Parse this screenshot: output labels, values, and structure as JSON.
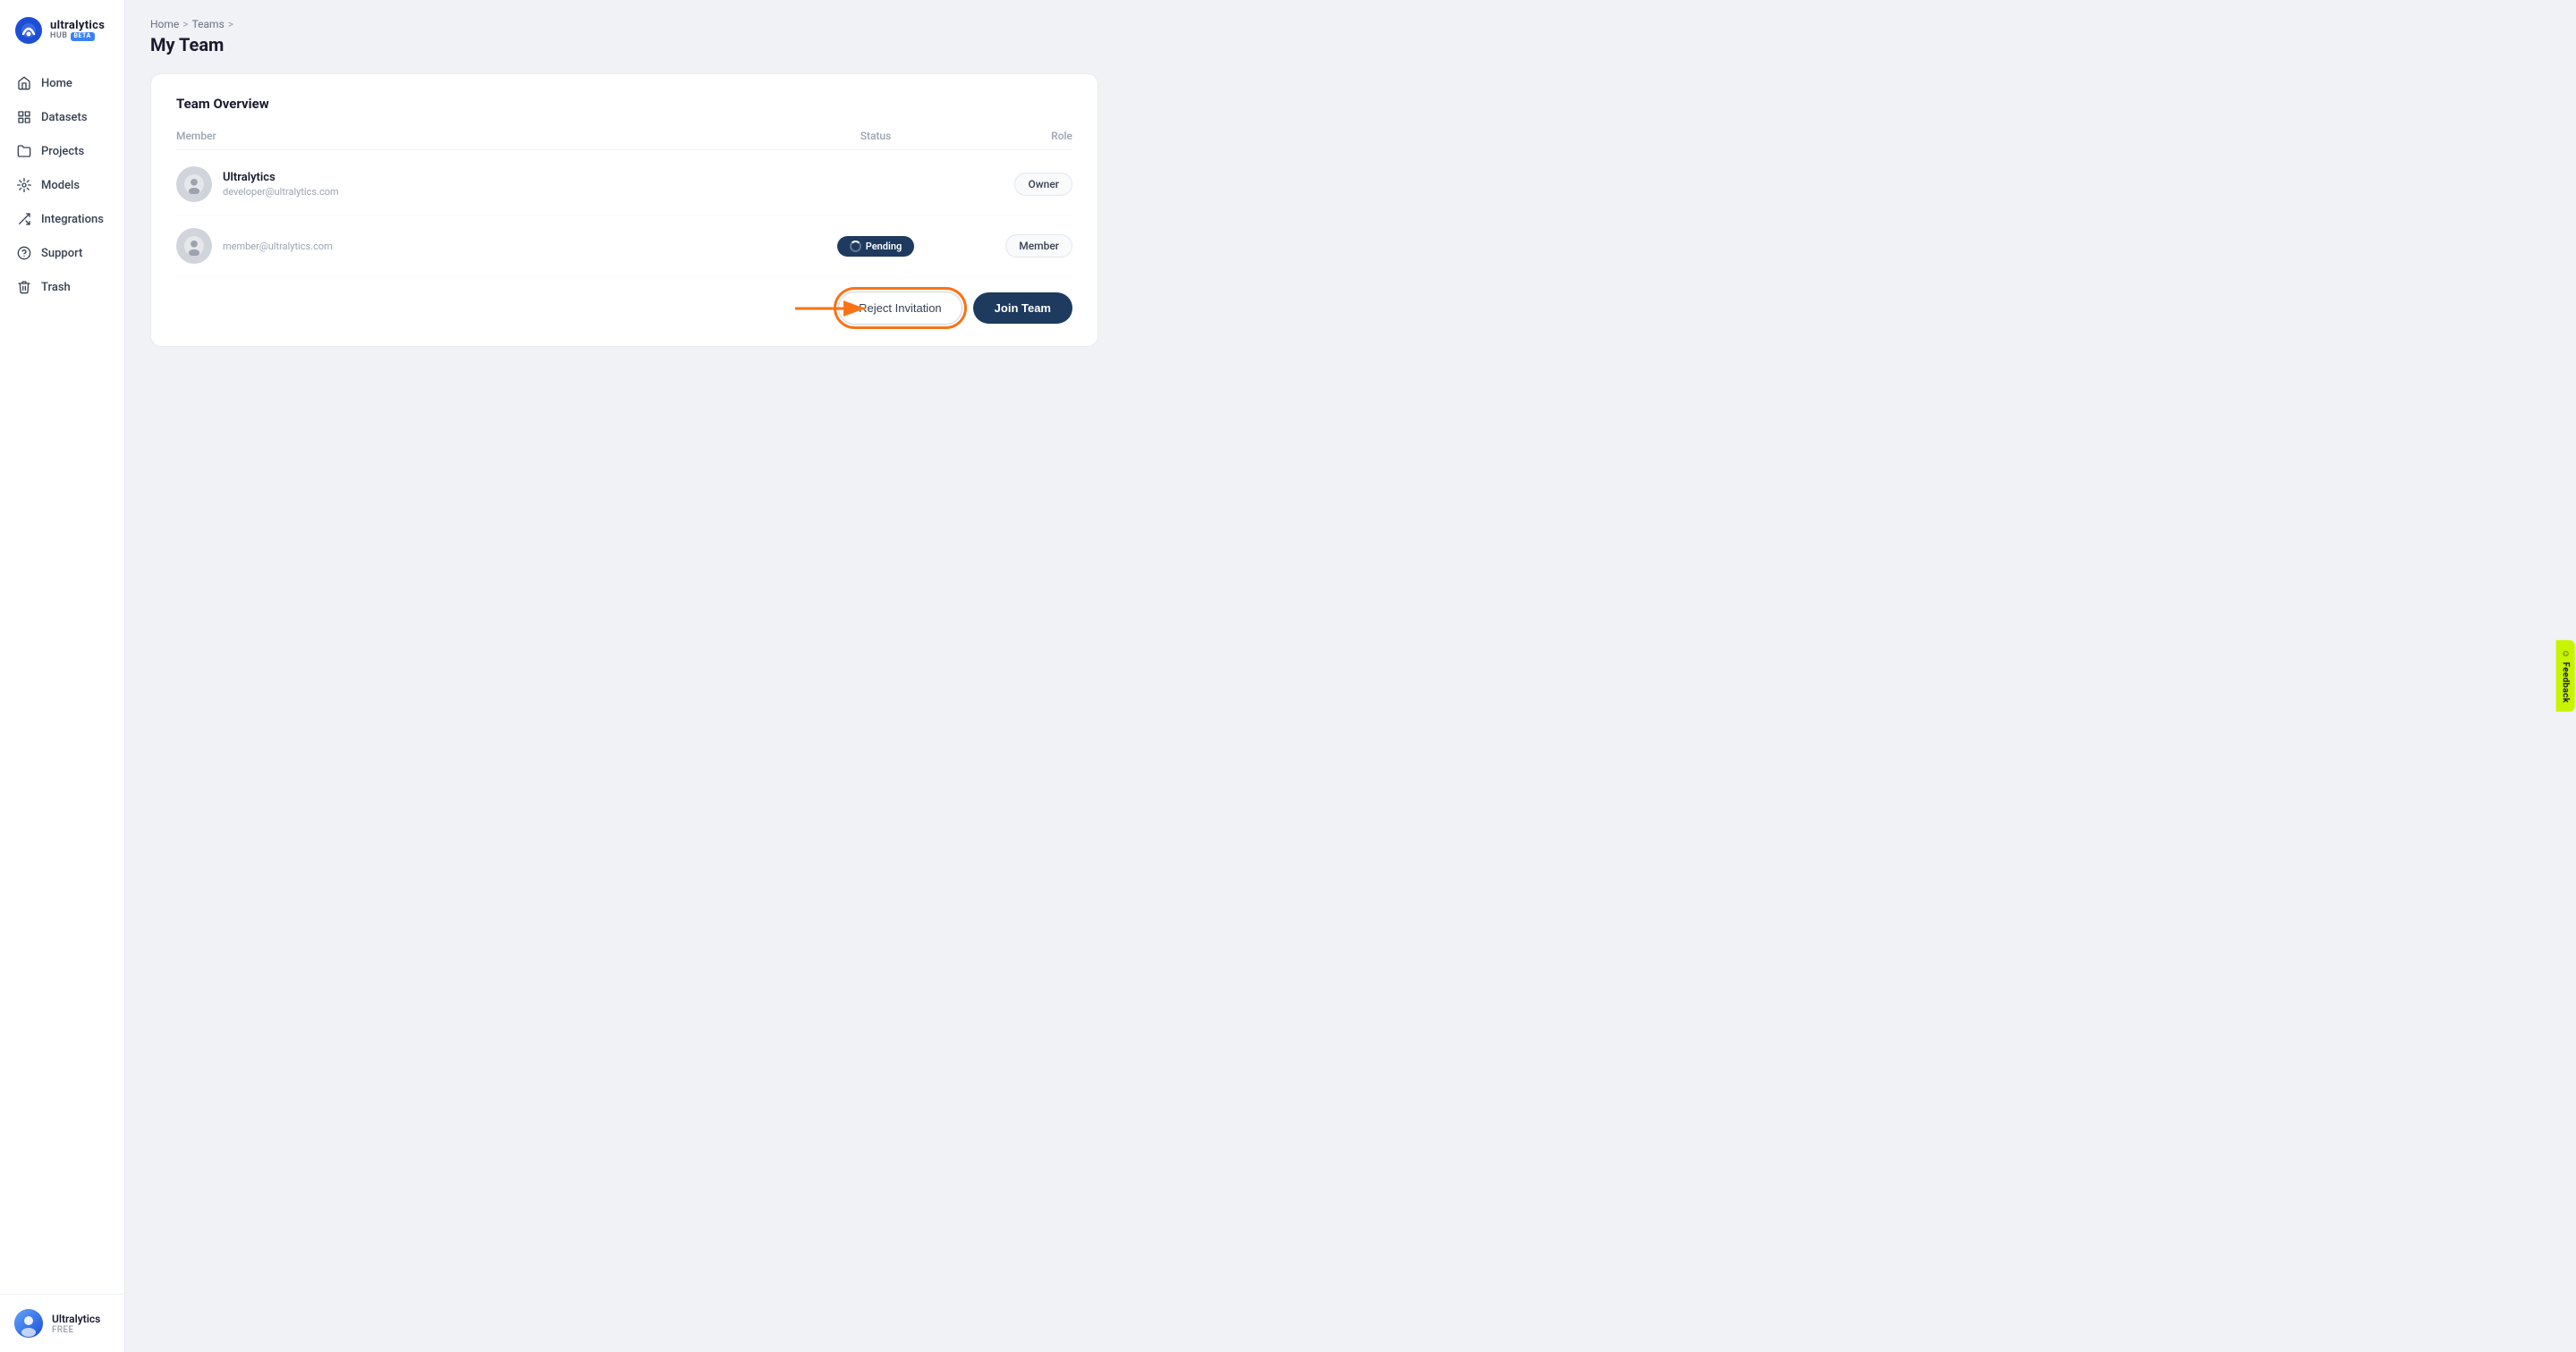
{
  "sidebar": {
    "logo": {
      "title": "ultralytics",
      "subtitle": "HUB",
      "beta": "BETA"
    },
    "nav_items": [
      {
        "id": "home",
        "label": "Home",
        "icon": "home"
      },
      {
        "id": "datasets",
        "label": "Datasets",
        "icon": "datasets"
      },
      {
        "id": "projects",
        "label": "Projects",
        "icon": "projects"
      },
      {
        "id": "models",
        "label": "Models",
        "icon": "models"
      },
      {
        "id": "integrations",
        "label": "Integrations",
        "icon": "integrations"
      },
      {
        "id": "support",
        "label": "Support",
        "icon": "support"
      },
      {
        "id": "trash",
        "label": "Trash",
        "icon": "trash"
      }
    ],
    "user": {
      "name": "Ultralytics",
      "plan": "FREE"
    }
  },
  "breadcrumb": {
    "items": [
      "Home",
      "Teams",
      "My Team"
    ],
    "separators": [
      ">",
      ">"
    ]
  },
  "page_title": "My Team",
  "team_overview": {
    "title": "Team Overview",
    "columns": {
      "member": "Member",
      "status": "Status",
      "role": "Role"
    },
    "members": [
      {
        "name": "Ultralytics",
        "email": "developer@ultralytics.com",
        "status": "",
        "role": "Owner"
      },
      {
        "name": "",
        "email": "member@ultralytics.com",
        "status": "Pending",
        "role": "Member"
      }
    ]
  },
  "actions": {
    "reject_label": "Reject Invitation",
    "join_label": "Join Team"
  },
  "feedback": {
    "label": "Feedback"
  }
}
